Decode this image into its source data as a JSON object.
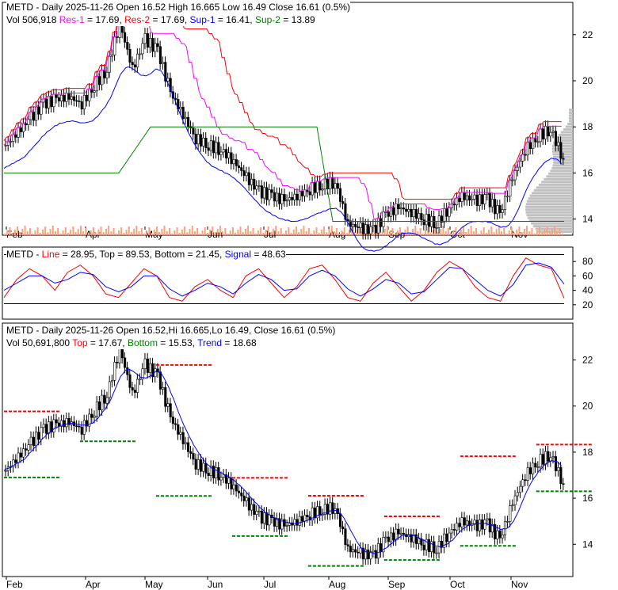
{
  "colors": {
    "red": "#ff0000",
    "magenta": "#ff00ff",
    "blue": "#0000ff",
    "green": "#008000",
    "volume": "#ff8c69",
    "profile": "#c0c0c0"
  },
  "chart_data": [
    {
      "type": "candlestick",
      "title": "METD - Daily 2025-11-26 Open 16.52  High 16.665  Low 16.49  Close 16.61 (0.5%)",
      "legend": {
        "vol": "Vol 506,918",
        "res1": "Res-1",
        "res1_val": " = 17.69, ",
        "res2": "Res-2",
        "res2_val": " = 17.69, ",
        "sup1": "Sup-1",
        "sup1_val": " = 16.41, ",
        "sup2": "Sup-2",
        "sup2_val": " = 13.89"
      },
      "yticks": [
        14,
        16,
        18,
        20,
        22
      ],
      "ylim": [
        13.3,
        23.4
      ],
      "xticks": [
        "Feb",
        "Apr",
        "May",
        "Jun",
        "Jul",
        "Aug",
        "Sep",
        "Oct",
        "Nov"
      ],
      "weekly_close": [
        17.2,
        17.8,
        18.4,
        19,
        19.2,
        19.3,
        19.0,
        19.8,
        20.5,
        22.5,
        20.5,
        21.8,
        21.3,
        19.5,
        18.5,
        17.5,
        17.2,
        17.0,
        16.5,
        15.8,
        15.2,
        15.0,
        14.8,
        15.0,
        15.3,
        15.5,
        15.6,
        13.8,
        13.6,
        13.5,
        14.2,
        14.5,
        14.3,
        14.0,
        13.8,
        14.5,
        15.0,
        14.8,
        14.9,
        14.2,
        15.8,
        17.0,
        17.6,
        17.9,
        16.6
      ]
    },
    {
      "type": "line",
      "title": "METD - ",
      "legend": {
        "line": "Line",
        "line_val": " = 28.95, Top = 89.53, Bottom = 21.45, ",
        "signal": "Signal",
        "signal_val": " = 48.63"
      },
      "yticks": [
        20,
        40,
        60,
        80
      ],
      "ylim": [
        0,
        100
      ],
      "line": [
        30,
        55,
        70,
        60,
        40,
        65,
        75,
        60,
        35,
        30,
        50,
        70,
        60,
        30,
        25,
        45,
        55,
        40,
        30,
        60,
        70,
        50,
        30,
        45,
        70,
        75,
        55,
        30,
        25,
        50,
        65,
        45,
        25,
        40,
        65,
        80,
        70,
        45,
        30,
        25,
        60,
        85,
        75,
        70,
        29
      ],
      "signal": [
        40,
        50,
        60,
        60,
        50,
        55,
        65,
        62,
        45,
        38,
        45,
        60,
        60,
        42,
        32,
        40,
        50,
        45,
        35,
        50,
        62,
        55,
        40,
        42,
        60,
        68,
        60,
        42,
        32,
        42,
        55,
        50,
        35,
        38,
        55,
        72,
        70,
        55,
        40,
        32,
        48,
        75,
        78,
        72,
        48.63
      ],
      "top": 89.53,
      "bottom": 21.45
    },
    {
      "type": "candlestick",
      "title": "METD - Daily 2025-11-26 Open 16.52,Hi 16.665,Lo 16.49, Close 16.61 (0.5%)",
      "legend": {
        "vol": "Vol 50,691,800 ",
        "top": "Top",
        "top_val": " = 17.67, ",
        "bottom": "Bottom",
        "bottom_val": " = 15.53, ",
        "trend": "Trend",
        "trend_val": " = 18.68"
      },
      "yticks": [
        14,
        16,
        18,
        20,
        22
      ],
      "ylim": [
        12.6,
        23.6
      ]
    }
  ]
}
